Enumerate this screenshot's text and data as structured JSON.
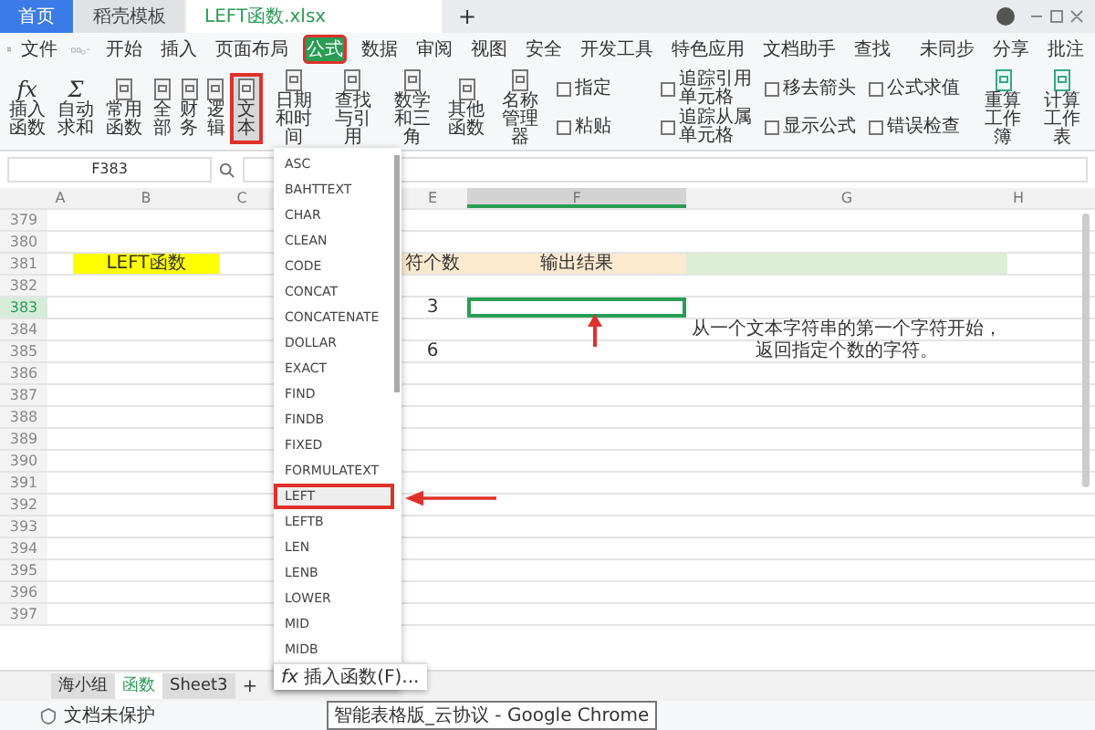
{
  "browser_tabs": [
    {
      "label": "首页",
      "kind": "home",
      "selected": false
    },
    {
      "label": "稻壳模板",
      "kind": "template",
      "selected": false
    },
    {
      "label": "LEFT函数.xlsx",
      "kind": "sheet",
      "selected": true
    }
  ],
  "new_tab": "+",
  "menu": {
    "file": "文件",
    "items": [
      {
        "label": "开始",
        "selected": false,
        "marked": false
      },
      {
        "label": "插入",
        "selected": false,
        "marked": false
      },
      {
        "label": "页面布局",
        "selected": false,
        "marked": false
      },
      {
        "label": "公式",
        "selected": true,
        "marked": true
      },
      {
        "label": "数据",
        "selected": false,
        "marked": false
      },
      {
        "label": "审阅",
        "selected": false,
        "marked": false
      },
      {
        "label": "视图",
        "selected": false,
        "marked": false
      },
      {
        "label": "安全",
        "selected": false,
        "marked": false
      },
      {
        "label": "开发工具",
        "selected": false,
        "marked": false
      },
      {
        "label": "特色应用",
        "selected": false,
        "marked": false
      },
      {
        "label": "文档助手",
        "selected": false,
        "marked": false
      }
    ],
    "search": "查找",
    "right": [
      "未同步",
      "分享",
      "批注"
    ]
  },
  "ribbon": {
    "large": [
      {
        "label": "插入函数",
        "glyph": "fx",
        "selected": false,
        "marked": false
      },
      {
        "label": "自动求和",
        "glyph": "Σ",
        "selected": false,
        "marked": false
      },
      {
        "label": "常用函数",
        "selected": false,
        "marked": false
      },
      {
        "label": "全部",
        "selected": false,
        "marked": false
      },
      {
        "label": "财务",
        "selected": false,
        "marked": false
      },
      {
        "label": "逻辑",
        "selected": false,
        "marked": false
      },
      {
        "label": "文本",
        "selected": true,
        "marked": true
      },
      {
        "label": "日期和时间",
        "selected": false,
        "marked": false
      },
      {
        "label": "查找与引用",
        "selected": false,
        "marked": false
      },
      {
        "label": "数学和三角",
        "selected": false,
        "marked": false
      },
      {
        "label": "其他函数",
        "selected": false,
        "marked": false
      },
      {
        "label": "名称管理器",
        "selected": false,
        "marked": false
      }
    ],
    "small": [
      "指定",
      "粘贴",
      "追踪引用单元格",
      "追踪从属单元格",
      "移去箭头",
      "显示公式",
      "公式求值",
      "错误检查"
    ],
    "end": [
      "重算工作簿",
      "计算工作表"
    ]
  },
  "name_box": "F383",
  "columns": {
    "A": {
      "label": "A",
      "selected": false
    },
    "B": {
      "label": "B",
      "selected": false
    },
    "C": {
      "label": "C",
      "selected": false
    },
    "E": {
      "label": "E",
      "selected": false
    },
    "F": {
      "label": "F",
      "selected": true
    },
    "G": {
      "label": "G",
      "selected": false
    },
    "H": {
      "label": "H",
      "selected": false
    }
  },
  "rows": [
    {
      "number": "379",
      "selected": false,
      "cells": {}
    },
    {
      "number": "380",
      "selected": false,
      "cells": {}
    },
    {
      "number": "381",
      "selected": false,
      "cells": {
        "B": {
          "text": "LEFT函数",
          "kind": "title",
          "selected": false
        },
        "E": {
          "text": "符个数",
          "kind": "label",
          "selected": false
        },
        "F": {
          "text": "输出结果",
          "kind": "label",
          "selected": false
        },
        "G": {
          "kind": "band",
          "selected": false
        }
      }
    },
    {
      "number": "382",
      "selected": false,
      "cells": {}
    },
    {
      "number": "383",
      "selected": true,
      "cells": {
        "E": {
          "text": "3",
          "kind": "plain",
          "selected": false
        },
        "F": {
          "kind": "plain",
          "selected": true
        }
      }
    },
    {
      "number": "384",
      "selected": false,
      "cells": {
        "G": {
          "text": "从一个文本字符串的第一个字符开始，",
          "kind": "note",
          "selected": false
        }
      }
    },
    {
      "number": "385",
      "selected": false,
      "cells": {
        "E": {
          "text": "6",
          "kind": "plain",
          "selected": false
        },
        "G": {
          "text": "返回指定个数的字符。",
          "kind": "note",
          "selected": false
        }
      }
    },
    {
      "number": "386",
      "selected": false,
      "cells": {}
    },
    {
      "number": "387",
      "selected": false,
      "cells": {}
    },
    {
      "number": "388",
      "selected": false,
      "cells": {}
    },
    {
      "number": "389",
      "selected": false,
      "cells": {}
    },
    {
      "number": "390",
      "selected": false,
      "cells": {}
    },
    {
      "number": "391",
      "selected": false,
      "cells": {}
    },
    {
      "number": "392",
      "selected": false,
      "cells": {}
    },
    {
      "number": "393",
      "selected": false,
      "cells": {}
    },
    {
      "number": "394",
      "selected": false,
      "cells": {}
    },
    {
      "number": "395",
      "selected": false,
      "cells": {}
    },
    {
      "number": "396",
      "selected": false,
      "cells": {}
    },
    {
      "number": "397",
      "selected": false,
      "cells": {}
    }
  ],
  "dropdown": {
    "items": [
      {
        "label": "ASC",
        "selected": false
      },
      {
        "label": "BAHTTEXT",
        "selected": false
      },
      {
        "label": "CHAR",
        "selected": false
      },
      {
        "label": "CLEAN",
        "selected": false
      },
      {
        "label": "CODE",
        "selected": false
      },
      {
        "label": "CONCAT",
        "selected": false
      },
      {
        "label": "CONCATENATE",
        "selected": false
      },
      {
        "label": "DOLLAR",
        "selected": false
      },
      {
        "label": "EXACT",
        "selected": false
      },
      {
        "label": "FIND",
        "selected": false
      },
      {
        "label": "FINDB",
        "selected": false
      },
      {
        "label": "FIXED",
        "selected": false
      },
      {
        "label": "FORMULATEXT",
        "selected": false
      },
      {
        "label": "LEFT",
        "selected": true
      },
      {
        "label": "LEFTB",
        "selected": false
      },
      {
        "label": "LEN",
        "selected": false
      },
      {
        "label": "LENB",
        "selected": false
      },
      {
        "label": "LOWER",
        "selected": false
      },
      {
        "label": "MID",
        "selected": false
      },
      {
        "label": "MIDB",
        "selected": false
      }
    ],
    "footer_glyph": "fx",
    "footer": "插入函数(F)..."
  },
  "sheets": [
    {
      "label": "海小组",
      "selected": false
    },
    {
      "label": "函数",
      "selected": true
    },
    {
      "label": "Sheet3",
      "selected": false
    }
  ],
  "add_sheet": "+",
  "status": "文档未保护",
  "tooltip": "智能表格版_云协议 - Google Chrome"
}
